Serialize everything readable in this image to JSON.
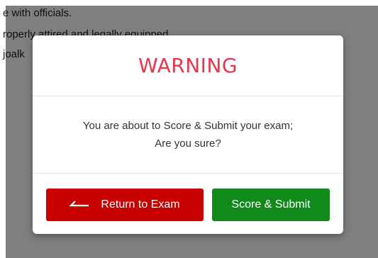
{
  "background": {
    "lines": [
      "e with officials.",
      "roperly attired and legally equipped",
      "joalk"
    ]
  },
  "modal": {
    "title": "WARNING",
    "message_line1": "You are about to Score & Submit your exam;",
    "message_line2": "Are you sure?",
    "return_button_label": "Return to Exam",
    "submit_button_label": "Score & Submit",
    "return_icon": "arrow-left-icon"
  },
  "colors": {
    "title": "#e8344e",
    "return_button": "#c80000",
    "submit_button": "#118a1c"
  }
}
